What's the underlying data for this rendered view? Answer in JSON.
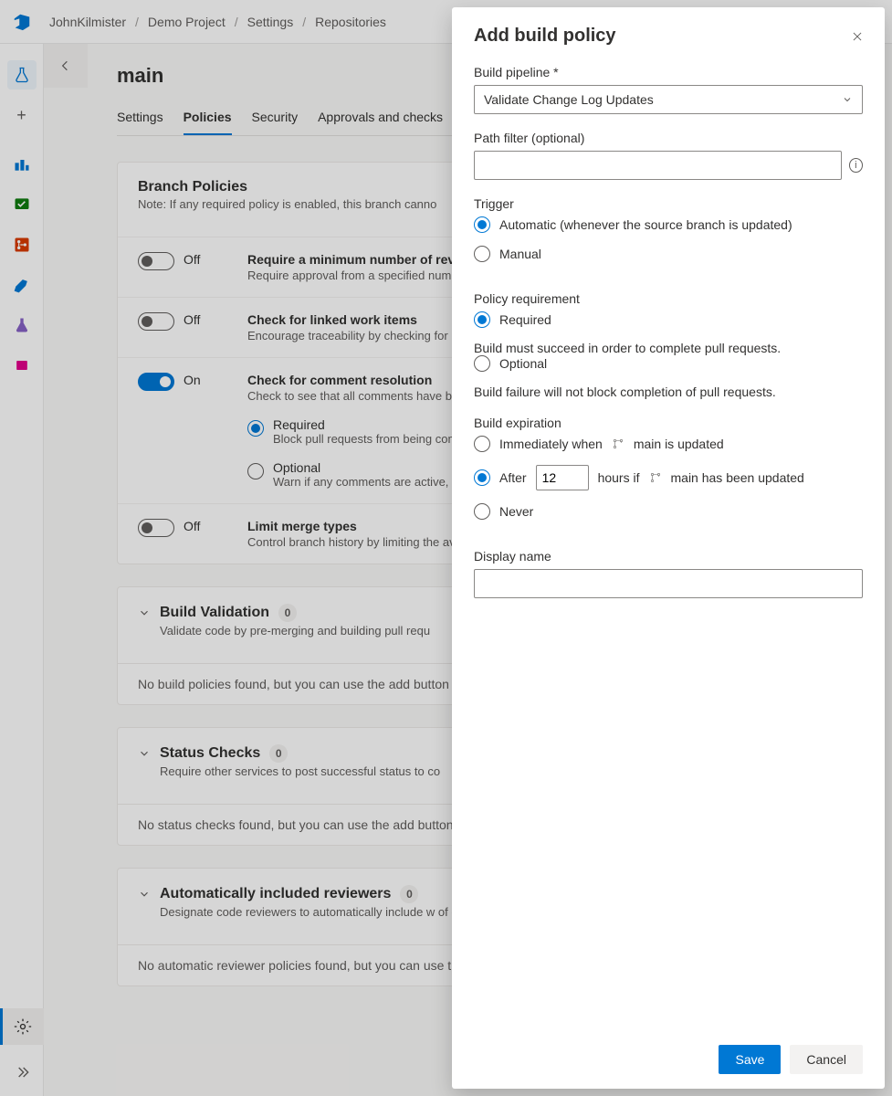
{
  "breadcrumbs": {
    "a": "JohnKilmister",
    "b": "Demo Project",
    "c": "Settings",
    "d": "Repositories"
  },
  "page": {
    "title": "main"
  },
  "tabs": {
    "settings": "Settings",
    "policies": "Policies",
    "security": "Security",
    "approvals": "Approvals and checks"
  },
  "branchPolicies": {
    "title": "Branch Policies",
    "note": "Note: If any required policy is enabled, this branch canno",
    "rows": {
      "minrev": {
        "state": "Off",
        "title": "Require a minimum number of rev",
        "desc": "Require approval from a specified numb reviewers on pull requests."
      },
      "linked": {
        "state": "Off",
        "title": "Check for linked work items",
        "desc": "Encourage traceability by checking for li items on pull requests."
      },
      "comment": {
        "state": "On",
        "title": "Check for comment resolution",
        "desc": "Check to see that all comments have bee on pull requests.",
        "required": {
          "label": "Required",
          "desc": "Block pull requests from being com are active."
        },
        "optional": {
          "label": "Optional",
          "desc": "Warn if any comments are active, b completed."
        }
      },
      "merge": {
        "state": "Off",
        "title": "Limit merge types",
        "desc": "Control branch history by limiting the av of merge when pull requests are comple"
      }
    }
  },
  "buildValidation": {
    "title": "Build Validation",
    "count": "0",
    "sub": "Validate code by pre-merging and building pull requ",
    "empty": "No build policies found, but you can use the add button"
  },
  "statusChecks": {
    "title": "Status Checks",
    "count": "0",
    "sub": "Require other services to post successful status to co",
    "empty": "No status checks found, but you can use the add button"
  },
  "autoReviewers": {
    "title": "Automatically included reviewers",
    "count": "0",
    "sub": "Designate code reviewers to automatically include w of code.",
    "empty": "No automatic reviewer policies found, but you can use t"
  },
  "panel": {
    "title": "Add build policy",
    "pipelineLabel": "Build pipeline *",
    "pipelineValue": "Validate Change Log Updates",
    "pathLabel": "Path filter (optional)",
    "triggerLabel": "Trigger",
    "triggerAuto": "Automatic (whenever the source branch is updated)",
    "triggerManual": "Manual",
    "policyReqLabel": "Policy requirement",
    "reqRequired": "Required",
    "reqRequiredDesc": "Build must succeed in order to complete pull requests.",
    "reqOptional": "Optional",
    "reqOptionalDesc": "Build failure will not block completion of pull requests.",
    "buildExpLabel": "Build expiration",
    "expImmediatePrefix": "Immediately when",
    "expImmediateSuffix": "main is updated",
    "expAfterPrefix": "After",
    "expAfterHours": "12",
    "expAfterMid": "hours if",
    "expAfterSuffix": "main has been updated",
    "expNever": "Never",
    "displayNameLabel": "Display name",
    "save": "Save",
    "cancel": "Cancel"
  }
}
